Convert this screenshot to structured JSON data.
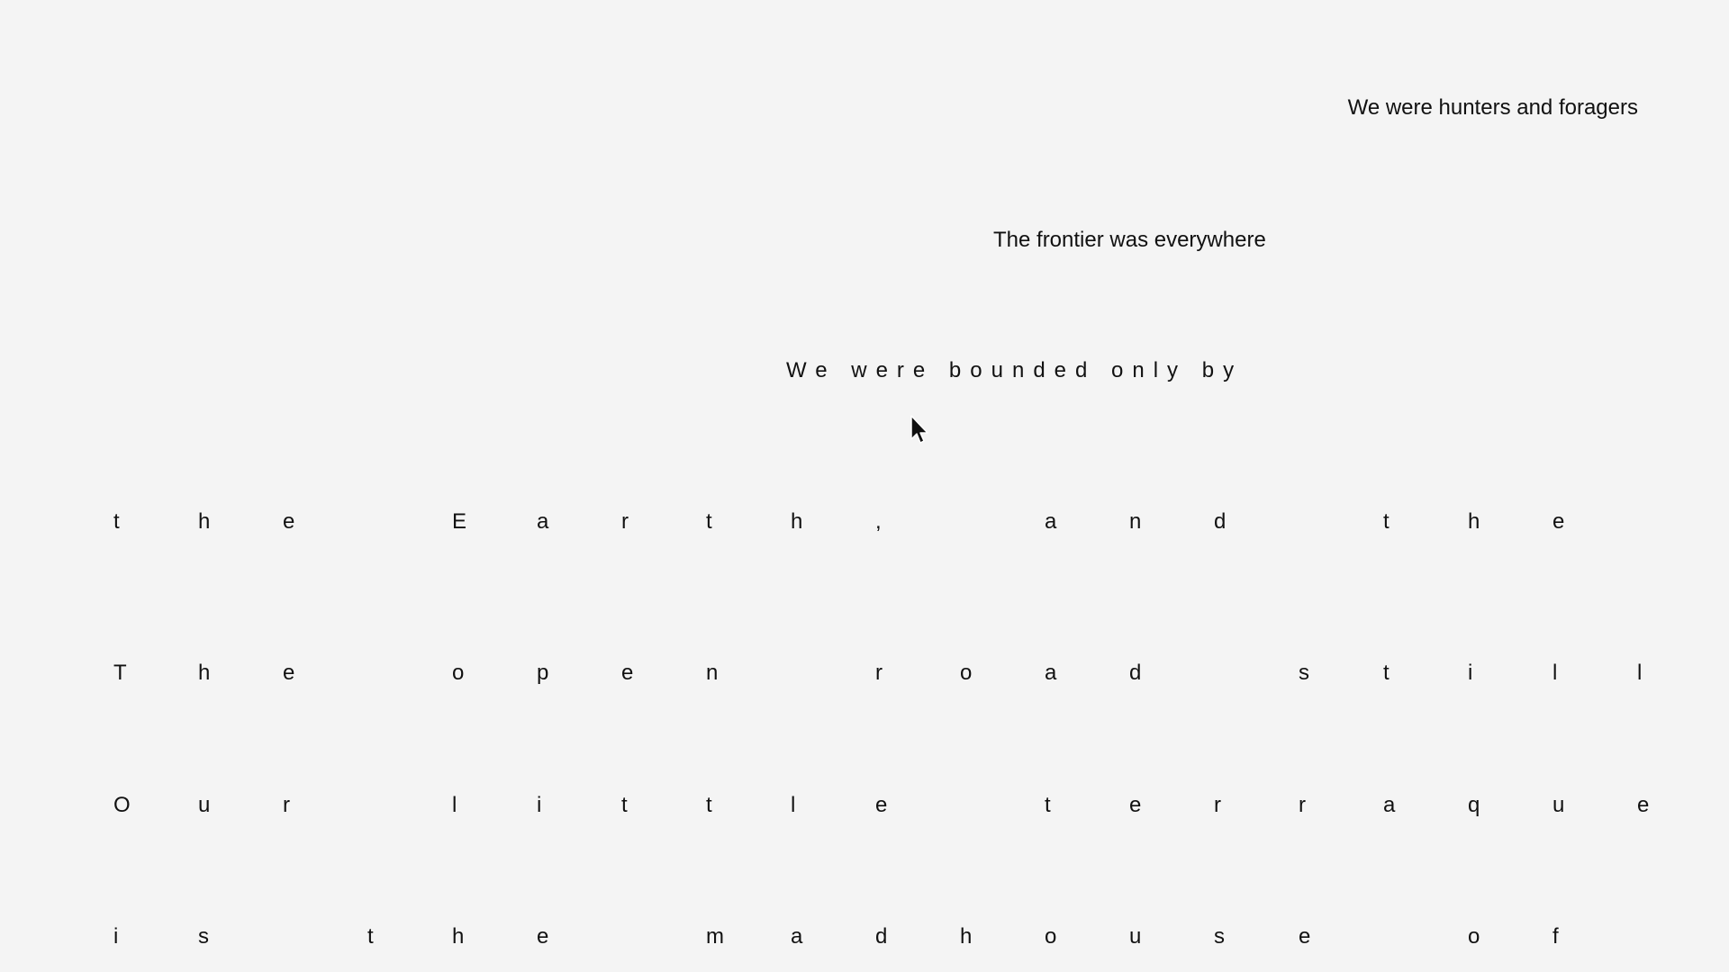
{
  "lines": {
    "line1": "We were hunters and foragers",
    "line2": "The frontier was everywhere",
    "line3": "We were bounded only by"
  },
  "rows": [
    "the Earth, and the oc",
    "The open road still",
    "Our little terraqueo",
    "is the madhouse of t"
  ],
  "cursor": {
    "icon": "arrow-cursor-icon"
  }
}
